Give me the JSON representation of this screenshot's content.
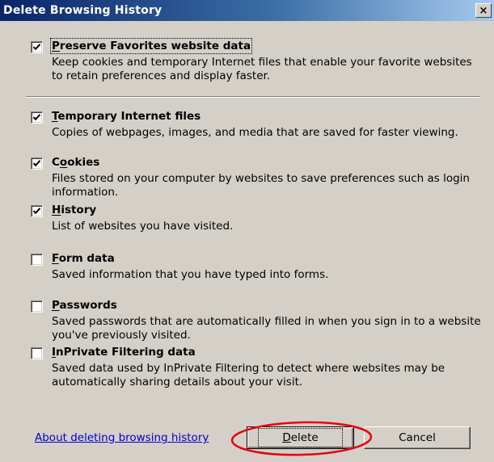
{
  "window": {
    "title": "Delete Browsing History",
    "close_glyph": "×"
  },
  "options": [
    {
      "label_key": "P",
      "label_rest": "reserve Favorites website data",
      "checked": true,
      "description": "Keep cookies and temporary Internet files that enable your favorite websites to retain preferences and display faster."
    },
    {
      "label_key": "T",
      "label_rest": "emporary Internet files",
      "checked": true,
      "description": "Copies of webpages, images, and media that are saved for faster viewing."
    },
    {
      "label_pre": "C",
      "label_key": "o",
      "label_rest": "okies",
      "checked": true,
      "description": "Files stored on your computer by websites to save preferences such as login information."
    },
    {
      "label_key": "H",
      "label_rest": "istory",
      "checked": true,
      "description": "List of websites you have visited."
    },
    {
      "label_key": "F",
      "label_rest": "orm data",
      "checked": false,
      "description": "Saved information that you have typed into forms."
    },
    {
      "label_key": "P",
      "label_rest": "asswords",
      "checked": false,
      "description": "Saved passwords that are automatically filled in when you sign in to a website you've previously visited."
    },
    {
      "label_key": "I",
      "label_rest": "nPrivate Filtering data",
      "checked": false,
      "description": "Saved data used by InPrivate Filtering to detect where websites may be automatically sharing details about your visit."
    }
  ],
  "footer": {
    "about_link": "About deleting browsing history",
    "delete_key": "D",
    "delete_rest": "elete",
    "cancel_label": "Cancel"
  },
  "colors": {
    "title_bar_start": "#0a246a",
    "dialog_face": "#d4d0c8",
    "link": "#0000cc",
    "annotation_circle": "#e8000b"
  }
}
